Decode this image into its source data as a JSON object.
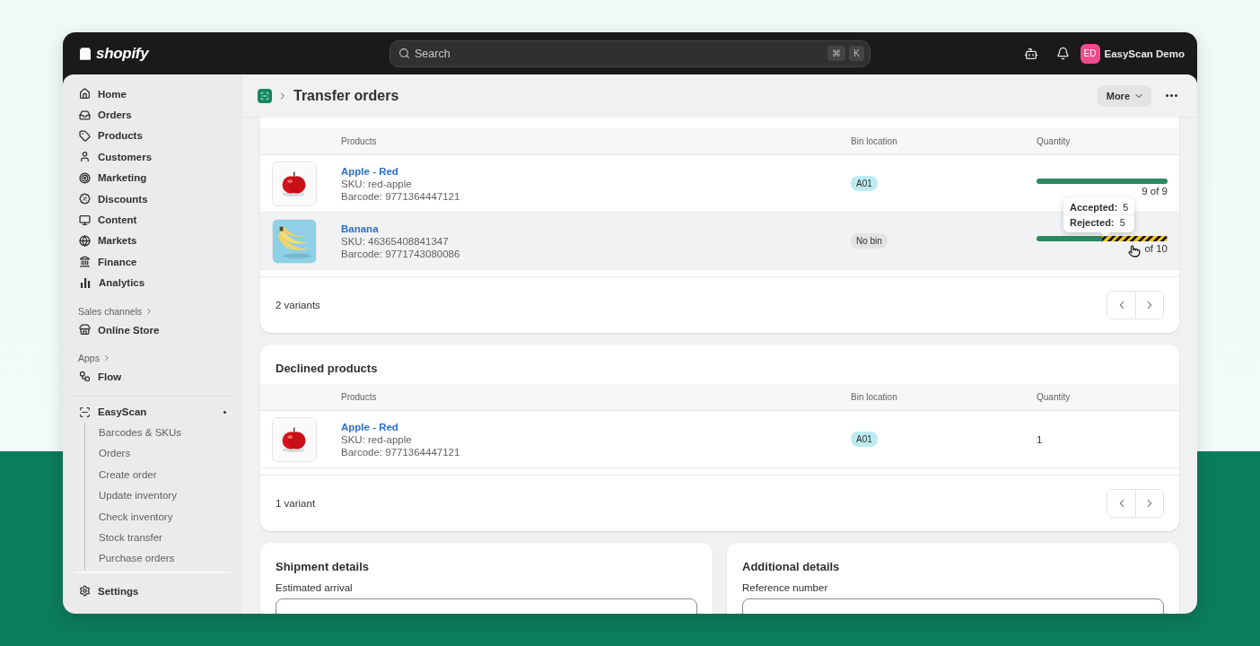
{
  "topbar": {
    "logo": "shopify",
    "search": {
      "placeholder": "Search",
      "keys": [
        "⌘",
        "K"
      ]
    },
    "store": {
      "initials": "ED",
      "name": "EasyScan Demo"
    }
  },
  "sidebar": {
    "items": [
      {
        "label": "Home"
      },
      {
        "label": "Orders"
      },
      {
        "label": "Products"
      },
      {
        "label": "Customers"
      },
      {
        "label": "Marketing"
      },
      {
        "label": "Discounts"
      },
      {
        "label": "Content"
      },
      {
        "label": "Markets"
      },
      {
        "label": "Finance"
      },
      {
        "label": "Analytics"
      }
    ],
    "sales_channels": {
      "heading": "Sales channels",
      "items": [
        {
          "label": "Online Store"
        }
      ]
    },
    "apps": {
      "heading": "Apps",
      "items": [
        {
          "label": "Flow"
        }
      ]
    },
    "app": {
      "label": "EasyScan",
      "children": [
        {
          "label": "Barcodes & SKUs"
        },
        {
          "label": "Orders"
        },
        {
          "label": "Create order"
        },
        {
          "label": "Update inventory"
        },
        {
          "label": "Check inventory"
        },
        {
          "label": "Stock transfer"
        },
        {
          "label": "Purchase orders"
        }
      ]
    },
    "settings": "Settings"
  },
  "page": {
    "title": "Transfer orders",
    "more_button": "More"
  },
  "product_list": {
    "columns": [
      "Products",
      "Bin location",
      "Quantity"
    ],
    "rows": [
      {
        "name": "Apple - Red",
        "sku": "SKU: red-apple",
        "barcode": "Barcode: 9771364447121",
        "hovered": false,
        "bin": {
          "text": "A01",
          "kind": "assigned"
        },
        "quantity": {
          "text": "9 of 9",
          "segments": [
            {
              "kind": "accepted",
              "level": 1
            }
          ]
        }
      },
      {
        "name": "Banana",
        "sku": "SKU: 46365408841347",
        "barcode": "Barcode: 9771743080086",
        "hovered": true,
        "bin": {
          "text": "No bin",
          "kind": "none"
        },
        "quantity": {
          "text": "of 10",
          "segments": [
            {
              "kind": "accepted",
              "level": 0.5
            },
            {
              "kind": "rejected",
              "level": 0.5
            }
          ],
          "tooltip": [
            {
              "label": "Accepted:",
              "value": "5"
            },
            {
              "label": "Rejected:",
              "value": "5"
            }
          ]
        }
      }
    ],
    "footer": "2 variants"
  },
  "declined_products": {
    "title": "Declined products",
    "columns": [
      "Products",
      "Bin location",
      "Quantity"
    ],
    "rows": [
      {
        "name": "Apple - Red",
        "sku": "SKU: red-apple",
        "barcode": "Barcode: 9771364447121",
        "hovered": false,
        "bin": {
          "text": "A01",
          "kind": "assigned"
        },
        "quantity": {
          "text": "1"
        }
      }
    ],
    "footer": "1 variant"
  },
  "shipment_details": {
    "title": "Shipment details",
    "field_label": "Estimated arrival"
  },
  "additional_details": {
    "title": "Additional details",
    "field_label": "Reference number"
  }
}
